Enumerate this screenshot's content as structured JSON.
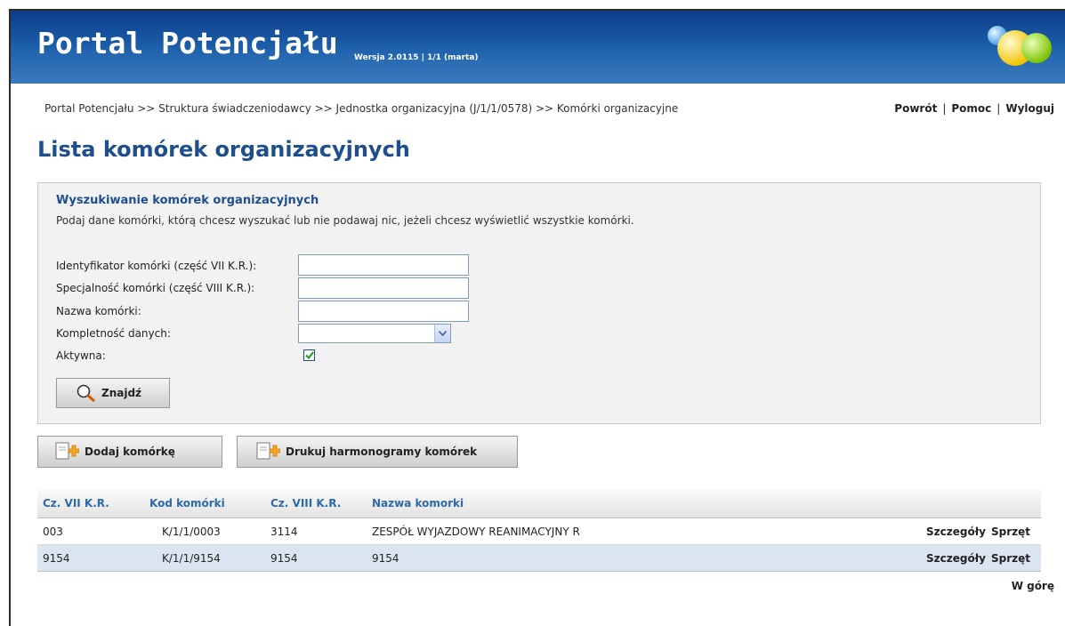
{
  "header": {
    "title": "Portal Potencjału",
    "version": "Wersja 2.0115 | 1/1 (marta)"
  },
  "breadcrumb": "Portal Potencjału >> Struktura świadczeniodawcy >> Jednostka organizacyjna (J/1/1/0578) >> Komórki organizacyjne",
  "topnav": {
    "back": "Powrót",
    "help": "Pomoc",
    "logout": "Wyloguj",
    "separator": "|"
  },
  "page_title": "Lista komórek organizacyjnych",
  "search": {
    "title": "Wyszukiwanie komórek organizacyjnych",
    "description": "Podaj dane komórki, którą chcesz wyszukać lub nie podawaj nic, jeżeli chcesz wyświetlić wszystkie komórki.",
    "fields": {
      "identifier_label": "Identyfikator komórki (część VII K.R.):",
      "identifier_value": "",
      "specialty_label": "Specjalność komórki (część VIII K.R.):",
      "specialty_value": "",
      "name_label": "Nazwa komórki:",
      "name_value": "",
      "completeness_label": "Kompletność danych:",
      "completeness_value": "",
      "active_label": "Aktywna:",
      "active_checked": true
    },
    "find_button": "Znajdź"
  },
  "actions": {
    "add_cell": "Dodaj komórkę",
    "print_schedules": "Drukuj harmonogramy komórek"
  },
  "table": {
    "columns": [
      "Cz. VII K.R.",
      "Kod komórki",
      "Cz. VIII K.R.",
      "Nazwa komorki"
    ],
    "rows": [
      {
        "cz7": "003",
        "kod": "K/1/1/0003",
        "cz8": "3114",
        "nazwa": "ZESPÓŁ WYJAZDOWY REANIMACYJNY R",
        "details": "Szczegóły",
        "equipment": "Sprzęt"
      },
      {
        "cz7": "9154",
        "kod": "K/1/1/9154",
        "cz8": "9154",
        "nazwa": "9154",
        "details": "Szczegóły",
        "equipment": "Sprzęt"
      }
    ]
  },
  "back_to_top": "W górę"
}
